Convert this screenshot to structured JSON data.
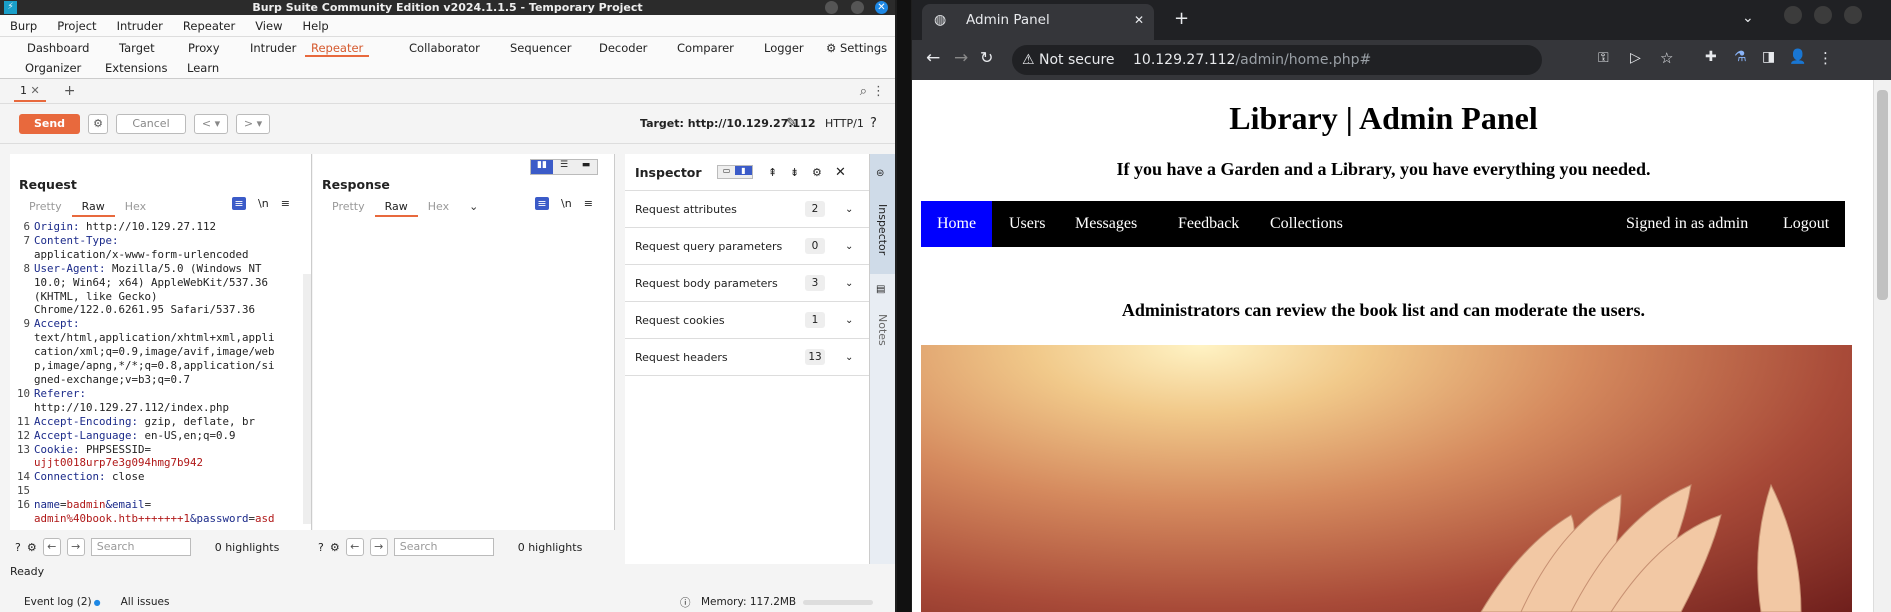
{
  "burp": {
    "title": "Burp Suite Community Edition v2024.1.1.5 - Temporary Project",
    "menu": [
      "Burp",
      "Project",
      "Intruder",
      "Repeater",
      "View",
      "Help"
    ],
    "tools_row1": [
      "Dashboard",
      "Target",
      "Proxy",
      "Intruder",
      "Repeater",
      "Collaborator",
      "Sequencer",
      "Decoder",
      "Comparer",
      "Logger",
      "Settings"
    ],
    "tools_row2": [
      "Organizer",
      "Extensions",
      "Learn"
    ],
    "active_tool": "Repeater",
    "repeater_tab": "1",
    "send": "Send",
    "cancel": "Cancel",
    "target": "Target: http://10.129.27.112",
    "http_version": "HTTP/1",
    "request": {
      "title": "Request",
      "tabs": [
        "Pretty",
        "Raw",
        "Hex"
      ],
      "active": "Raw",
      "lines": [
        {
          "n": "6",
          "key": "Origin:",
          "val": " http://10.129.27.112"
        },
        {
          "n": "7",
          "key": "Content-Type:",
          "val": ""
        },
        {
          "n": "",
          "key": "",
          "val": "application/x-www-form-urlencoded"
        },
        {
          "n": "8",
          "key": "User-Agent:",
          "val": " Mozilla/5.0 (Windows NT"
        },
        {
          "n": "",
          "key": "",
          "val": "10.0; Win64; x64) AppleWebKit/537.36"
        },
        {
          "n": "",
          "key": "",
          "val": "(KHTML, like Gecko)"
        },
        {
          "n": "",
          "key": "",
          "val": "Chrome/122.0.6261.95 Safari/537.36"
        },
        {
          "n": "9",
          "key": "Accept:",
          "val": ""
        },
        {
          "n": "",
          "key": "",
          "val": "text/html,application/xhtml+xml,appli"
        },
        {
          "n": "",
          "key": "",
          "val": "cation/xml;q=0.9,image/avif,image/web"
        },
        {
          "n": "",
          "key": "",
          "val": "p,image/apng,*/*;q=0.8,application/si"
        },
        {
          "n": "",
          "key": "",
          "val": "gned-exchange;v=b3;q=0.7"
        },
        {
          "n": "10",
          "key": "Referer:",
          "val": ""
        },
        {
          "n": "",
          "key": "",
          "val": "http://10.129.27.112/index.php"
        },
        {
          "n": "11",
          "key": "Accept-Encoding:",
          "val": " gzip, deflate, br"
        },
        {
          "n": "12",
          "key": "Accept-Language:",
          "val": " en-US,en;q=0.9"
        },
        {
          "n": "13",
          "key": "Cookie:",
          "val": " PHPSESSID=",
          "red": ""
        },
        {
          "n": "",
          "key": "",
          "val": "",
          "red": "ujjt0018urp7e3g094hmg7b942"
        },
        {
          "n": "14",
          "key": "Connection:",
          "val": " close"
        },
        {
          "n": "15",
          "key": "",
          "val": ""
        },
        {
          "n": "16",
          "key": "name",
          "val": "=",
          "red": "badmin",
          "key2": "&email",
          "val2": "="
        },
        {
          "n": "",
          "key": "",
          "val": "",
          "red": "admin%40book.htb+++++++1",
          "key2": "&password",
          "val2": "=",
          "red2": "asd"
        }
      ],
      "highlights": "0 highlights",
      "search_placeholder": "Search"
    },
    "response": {
      "title": "Response",
      "tabs": [
        "Pretty",
        "Raw",
        "Hex"
      ],
      "active": "Raw",
      "highlights": "0 highlights",
      "search_placeholder": "Search"
    },
    "inspector": {
      "title": "Inspector",
      "rows": [
        {
          "label": "Request attributes",
          "count": "2"
        },
        {
          "label": "Request query parameters",
          "count": "0"
        },
        {
          "label": "Request body parameters",
          "count": "3"
        },
        {
          "label": "Request cookies",
          "count": "1"
        },
        {
          "label": "Request headers",
          "count": "13"
        }
      ],
      "side_tabs": [
        "Inspector",
        "Notes"
      ]
    },
    "status": "Ready",
    "event_log": "Event log (2)",
    "all_issues": "All issues",
    "memory": "Memory: 117.2MB"
  },
  "chrome": {
    "tab_title": "Admin Panel",
    "not_secure": "Not secure",
    "url_host": "10.129.27.112",
    "url_path": "/admin/home.php#"
  },
  "site": {
    "heading": "Library | Admin Panel",
    "tagline": "If you have a Garden and a Library, you have everything you needed.",
    "nav": [
      "Home",
      "Users",
      "Messages",
      "Feedback",
      "Collections"
    ],
    "signed_in": "Signed in as admin",
    "logout": "Logout",
    "notice": "Administrators can review the book list and can moderate the users."
  }
}
